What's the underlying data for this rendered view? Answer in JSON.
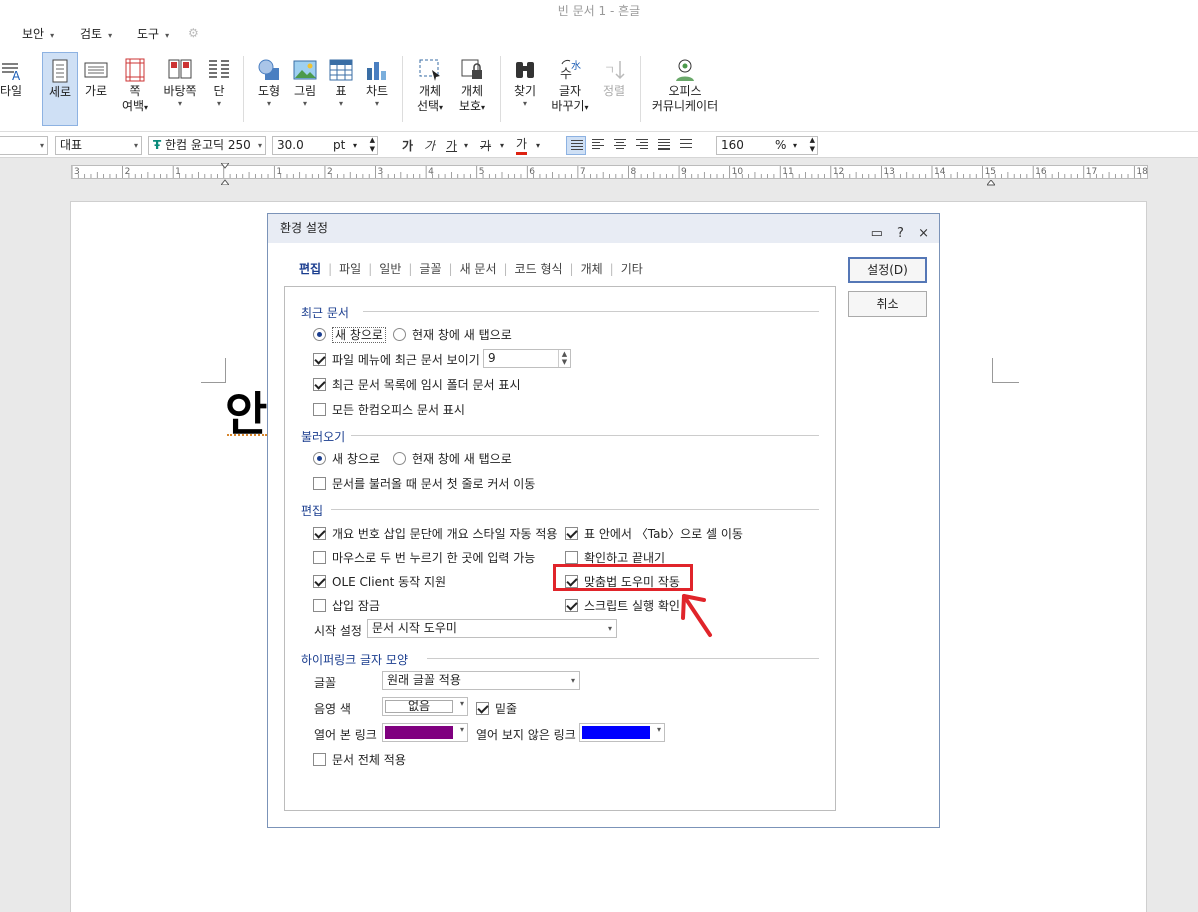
{
  "window": {
    "title": "빈 문서 1 - 흔글"
  },
  "menu": {
    "items": [
      "보안",
      "검토",
      "도구"
    ]
  },
  "ribbon": {
    "partial_label": "타일",
    "buttons": [
      {
        "label": "세로",
        "sub": ""
      },
      {
        "label": "가로",
        "sub": ""
      },
      {
        "label": "쪽",
        "label2": "여백",
        "sub": "▾"
      },
      {
        "label": "바탕쪽",
        "sub": "▾"
      },
      {
        "label": "단",
        "sub": "▾"
      },
      {
        "label": "도형",
        "sub": "▾"
      },
      {
        "label": "그림",
        "sub": "▾"
      },
      {
        "label": "표",
        "sub": "▾"
      },
      {
        "label": "차트",
        "sub": "▾"
      },
      {
        "label": "개체",
        "label2": "선택",
        "sub": "▾"
      },
      {
        "label": "개체",
        "label2": "보호",
        "sub": "▾"
      },
      {
        "label": "찾기",
        "sub": "▾"
      },
      {
        "label": "글자",
        "label2": "바꾸기",
        "sub": "▾"
      },
      {
        "label": "정렬",
        "sub": ""
      },
      {
        "label": "오피스",
        "label2": "커뮤니케이터",
        "sub": ""
      }
    ]
  },
  "format_bar": {
    "style": "대표",
    "font": "한컴 윤고딕 250",
    "font_prefix": "Ŧ",
    "size": "30.0",
    "size_unit": "pt",
    "bold": "가",
    "italic": "가",
    "underline": "가",
    "strike": "가",
    "color": "가",
    "zoom": "160",
    "zoom_unit": "%"
  },
  "ruler": {
    "labels": [
      "3",
      "2",
      "1",
      "",
      "1",
      "2",
      "3",
      "4",
      "5",
      "6",
      "7",
      "8",
      "9",
      "10",
      "11",
      "12",
      "13",
      "14",
      "15",
      "16",
      "17",
      "18"
    ]
  },
  "document": {
    "visible_char": "안"
  },
  "dialog": {
    "title": "환경 설정",
    "ctrl_help": "?",
    "ctrl_close": "×",
    "ctrl_menu": "▭",
    "tabs": [
      "편집",
      "파일",
      "일반",
      "글꼴",
      "새 문서",
      "코드 형식",
      "개체",
      "기타"
    ],
    "selected_tab": "편집",
    "ok_button": "설정(D)",
    "cancel_button": "취소",
    "recent": {
      "heading": "최근 문서",
      "radio_new": "새 창으로",
      "radio_tab": "현재 창에 새 탭으로",
      "show_recent": "파일 메뉴에 최근 문서 보이기",
      "recent_count": "9",
      "show_temp": "최근 문서 목록에 임시 폴더 문서 표시",
      "show_all": "모든 한컴오피스 문서 표시"
    },
    "open": {
      "heading": "불러오기",
      "radio_new": "새 창으로",
      "radio_tab": "현재 창에 새 탭으로",
      "cursor_first": "문서를 불러올 때 문서 첫 줄로 커서 이동"
    },
    "edit": {
      "heading": "편집",
      "outline_style": "개요 번호 삽입 문단에 개요 스타일 자동 적용",
      "tab_move": "표 안에서 〈Tab〉으로 셀 이동",
      "double_click": "마우스로 두 번 누르기 한 곳에 입력 가능",
      "confirm_end": "확인하고 끝내기",
      "ole": "OLE Client 동작 지원",
      "spell_helper": "맞춤법 도우미 작동",
      "insert_lock": "삽입 잠금",
      "script_confirm": "스크립트 실행 확인",
      "start_label": "시작 설정",
      "start_value": "문서 시작 도우미"
    },
    "hyperlink": {
      "heading": "하이퍼링크 글자 모양",
      "font_label": "글꼴",
      "font_value": "원래 글꼴 적용",
      "shade_label": "음영 색",
      "shade_value": "없음",
      "underline_label": "밑줄",
      "visited_label": "열어 본 링크",
      "visited_color": "#7f007f",
      "unvisited_label": "열어 보지 않은 링크",
      "unvisited_color": "#0000ff",
      "apply_all": "문서 전체 적용"
    }
  },
  "colors": {
    "accent": "#1a3d8f",
    "highlight": "#e0242a"
  }
}
